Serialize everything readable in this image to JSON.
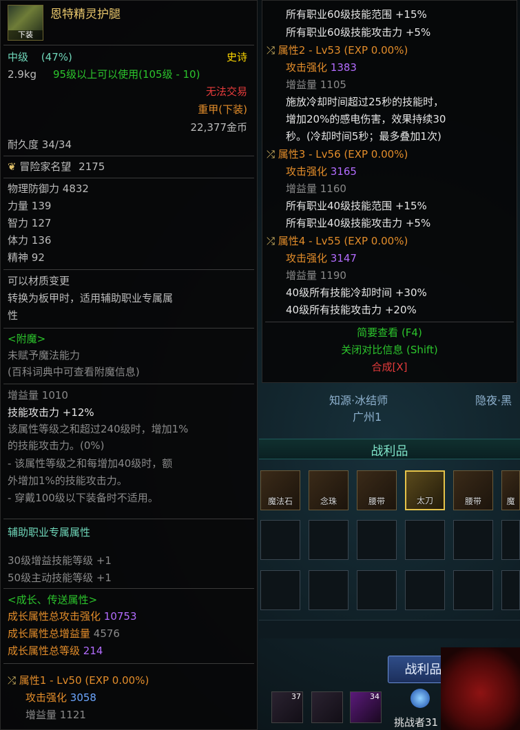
{
  "item": {
    "name": "恩特精灵护腿",
    "icon_tag": "下装",
    "grade": "中级",
    "grade_pct": "(47%)",
    "rarity": "史诗",
    "weight": "2.9kg",
    "level_req": "95级以上可以使用(105级 - 10)",
    "trade": "无法交易",
    "type": "重甲(下装)",
    "price": "22,377金币",
    "durability": "耐久度 34/34",
    "fame_label": "冒险家名望",
    "fame_value": "2175",
    "stats": [
      {
        "label": "物理防御力",
        "value": "4832"
      },
      {
        "label": "力量",
        "value": "139"
      },
      {
        "label": "智力",
        "value": "127"
      },
      {
        "label": "体力",
        "value": "136"
      },
      {
        "label": "精神",
        "value": "92"
      }
    ],
    "material_change": "可以材质变更",
    "convert_line1": "转换为板甲时，适用辅助职业专属属",
    "convert_line2": "性",
    "enchant_header": "<附魔>",
    "enchant_none": "未赋予魔法能力",
    "enchant_hint": "(百科词典中可查看附魔信息)",
    "buff_label": "增益量",
    "buff_value": "1010",
    "skill_atk": "技能攻击力 +12%",
    "desc": [
      "该属性等级之和超过240级时，增加1%",
      "的技能攻击力。(0%)",
      "- 该属性等级之和每增加40级时，额",
      "外增加1%的技能攻击力。",
      "- 穿戴100级以下装备时不适用。"
    ],
    "support_header": "辅助职业专属属性",
    "support_lines": [
      "30级增益技能等级 +1",
      "50级主动技能等级 +1"
    ],
    "growth_header": "<成长、传送属性>",
    "growth_atk_label": "成长属性总攻击强化",
    "growth_atk_value": "10753",
    "growth_buff_label": "成长属性总增益量",
    "growth_buff_value": "4576",
    "growth_lv_label": "成长属性总等级",
    "growth_lv_value": "214",
    "attr1_title": "属性1 - Lv50 (EXP 0.00%)",
    "attr1_atk_label": "攻击强化",
    "attr1_atk_value": "3058",
    "attr1_buff_label": "增益量",
    "attr1_buff_value": "1121"
  },
  "right": {
    "top_lines": [
      "所有职业60级技能范围 +15%",
      "所有职业60级技能攻击力 +5%"
    ],
    "attr2_title": "属性2 - Lv53 (EXP 0.00%)",
    "attr2_atk_label": "攻击强化",
    "attr2_atk_value": "1383",
    "attr2_buff": "增益量 1105",
    "attr2_desc": [
      "施放冷却时间超过25秒的技能时，",
      "增加20%的感电伤害，效果持续30",
      "秒。(冷却时间5秒；最多叠加1次)"
    ],
    "attr3_title": "属性3 - Lv56 (EXP 0.00%)",
    "attr3_atk_label": "攻击强化",
    "attr3_atk_value": "3165",
    "attr3_buff": "增益量 1160",
    "attr3_lines": [
      "所有职业40级技能范围 +15%",
      "所有职业40级技能攻击力 +5%"
    ],
    "attr4_title": "属性4 - Lv55 (EXP 0.00%)",
    "attr4_atk_label": "攻击强化",
    "attr4_atk_value": "3147",
    "attr4_buff": "增益量 1190",
    "attr4_lines": [
      "40级所有技能冷却时间 +30%",
      "40级所有技能攻击力 +20%"
    ],
    "brief": "简要查看 (F4)",
    "close_compare": "关闭对比信息 (Shift)",
    "synth": "合成[X]"
  },
  "game": {
    "player1_name": "知源·冰结师",
    "player1_server": "广州1",
    "player2_name": "隐夜·黑",
    "loot_title": "战利品",
    "loot_items": [
      "魔法石",
      "念珠",
      "腰带",
      "太刀",
      "腰带",
      "魔"
    ],
    "done_button": "战利品分配完毕",
    "hot_counts": [
      "37",
      "34"
    ],
    "challenger": "挑战者31"
  }
}
